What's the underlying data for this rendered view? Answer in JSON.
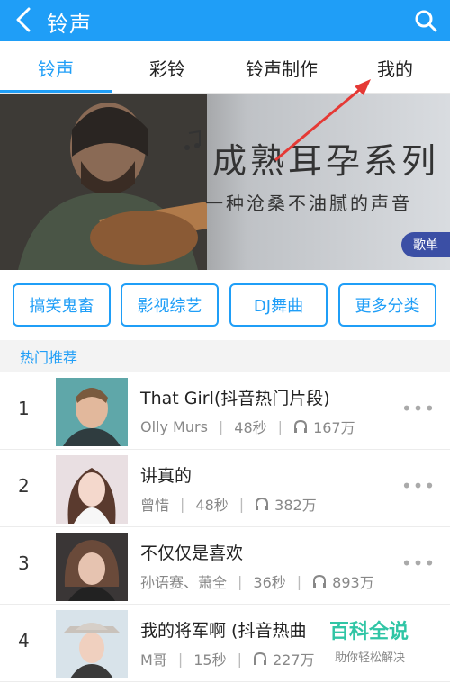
{
  "header": {
    "title": "铃声",
    "bg_color": "#1f9ef7"
  },
  "tabs": [
    {
      "label": "铃声",
      "active": true
    },
    {
      "label": "彩铃",
      "active": false
    },
    {
      "label": "铃声制作",
      "active": false
    },
    {
      "label": "我的",
      "active": false
    }
  ],
  "banner": {
    "title": "成熟耳孕系列",
    "subtitle": "一种沧桑不油腻的声音",
    "tag": "歌单"
  },
  "categories": [
    "搞笑鬼畜",
    "影视综艺",
    "DJ舞曲",
    "更多分类"
  ],
  "section": {
    "title": "热门推荐"
  },
  "songs": [
    {
      "rank": "1",
      "title": "That Girl(抖音热门片段)",
      "artist": "Olly Murs",
      "duration": "48秒",
      "plays": "167万"
    },
    {
      "rank": "2",
      "title": "讲真的",
      "artist": "曾惜",
      "duration": "48秒",
      "plays": "382万"
    },
    {
      "rank": "3",
      "title": "不仅仅是喜欢",
      "artist": "孙语赛、萧全",
      "duration": "36秒",
      "plays": "893万"
    },
    {
      "rank": "4",
      "title": "我的将军啊 (抖音热曲",
      "artist": "M哥",
      "duration": "15秒",
      "plays": "227万"
    }
  ],
  "watermark": {
    "title": "百科全说",
    "subtitle": "助你轻松解决"
  }
}
